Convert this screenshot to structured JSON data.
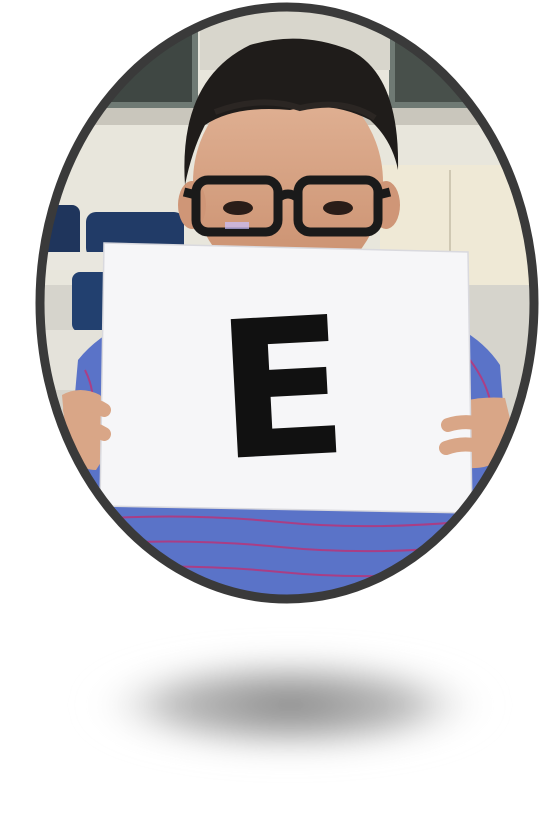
{
  "sign": {
    "letter": "E"
  },
  "colors": {
    "frame_border": "#3a3a3a",
    "background_wall": "#e8e6dc",
    "window_frame": "#6f7a74",
    "window_glass": "#3f4743",
    "ceiling_trim": "#c9c6bc",
    "chair_blue": "#213b67",
    "desk_top": "#e9e7df",
    "floor": "#d6d4cc",
    "hair": "#1f1c1a",
    "skin": "#d9a687",
    "glasses": "#1a1a1a",
    "paper": "#f6f6f8",
    "letter_ink": "#111111",
    "shirt_blue": "#5a73c8",
    "shirt_stripe": "#b8367a",
    "shadow": "#7a7a7a"
  },
  "icons": {
    "frame": "oval-photo-frame",
    "shadow": "drop-shadow"
  }
}
